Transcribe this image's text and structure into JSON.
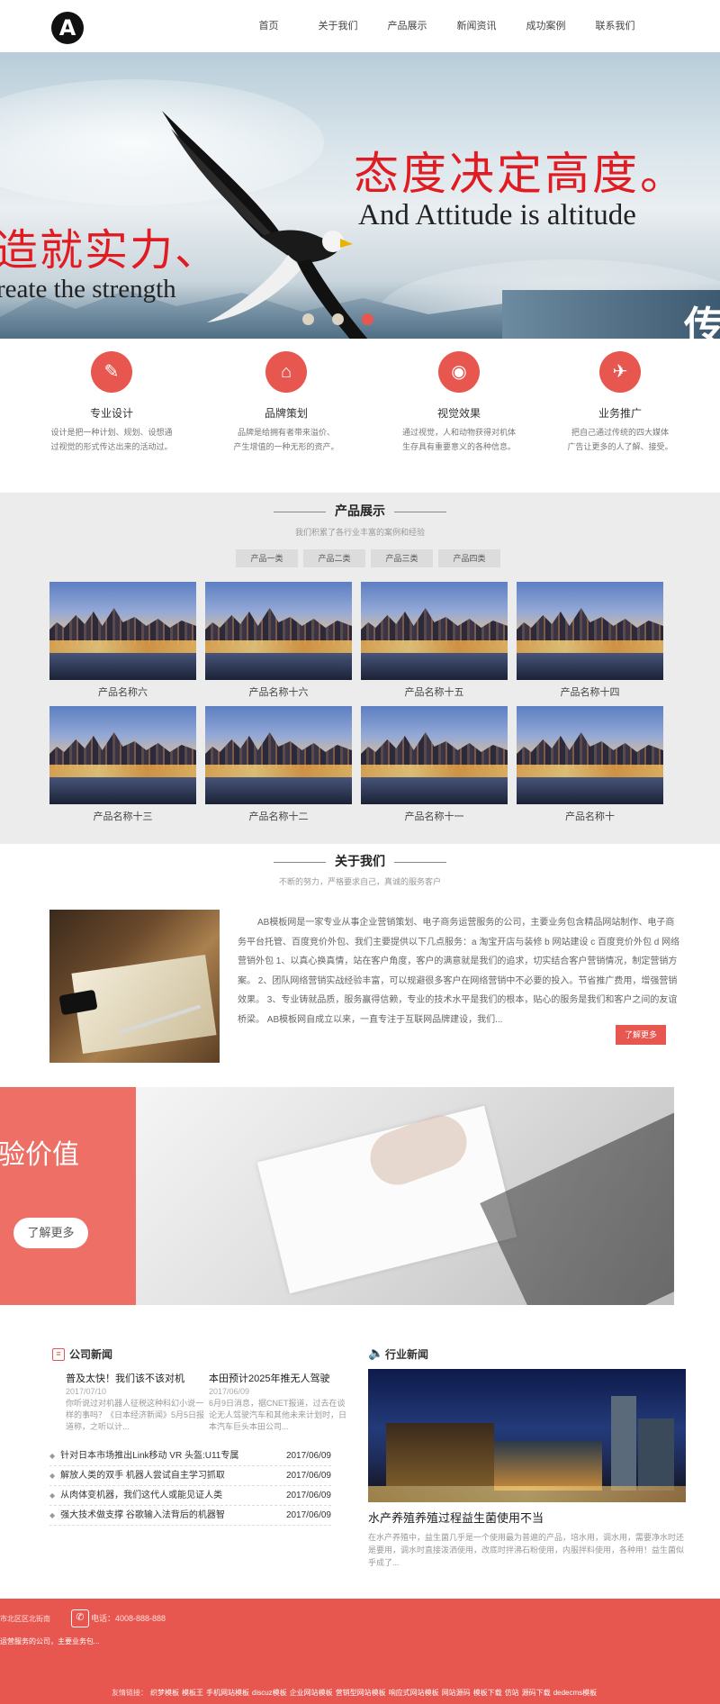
{
  "header": {
    "logo_letter": "A",
    "nav": [
      "首页",
      "关于我们",
      "产品展示",
      "新闻资讯",
      "成功案例",
      "联系我们"
    ]
  },
  "banner": {
    "main_cn": "态度决定高度。",
    "main_en": "And Attitude is altitude",
    "left_cn": "造就实力、",
    "left_en": "reate the strength",
    "rock_char": "传",
    "active_slide": 3,
    "slide_count": 3
  },
  "services": [
    {
      "icon": "edit-icon",
      "glyph": "✎",
      "title": "专业设计",
      "desc1": "设计是把一种计划、规划、设想通",
      "desc2": "过视觉的形式传达出来的活动过。"
    },
    {
      "icon": "tag-icon",
      "glyph": "⌂",
      "title": "品牌策划",
      "desc1": "品牌是给拥有者带来溢价、",
      "desc2": "产生增值的一种无形的资产。"
    },
    {
      "icon": "camera-icon",
      "glyph": "◉",
      "title": "视觉效果",
      "desc1": "通过视觉，人和动物获得对机体",
      "desc2": "生存具有重要意义的各种信息。"
    },
    {
      "icon": "airplane-icon",
      "glyph": "✈",
      "title": "业务推广",
      "desc1": "把自己通过传统的四大媒体",
      "desc2": "广告让更多的人了解、接受。"
    }
  ],
  "products": {
    "title": "产品展示",
    "subtitle": "我们积累了各行业丰富的案例和经验",
    "tabs": [
      "产品一类",
      "产品二类",
      "产品三类",
      "产品四类"
    ],
    "items": [
      "产品名称六",
      "产品名称十六",
      "产品名称十五",
      "产品名称十四",
      "产品名称十三",
      "产品名称十二",
      "产品名称十一",
      "产品名称十"
    ]
  },
  "about": {
    "title": "关于我们",
    "subtitle": "不断的努力，严格要求自己，真诚的服务客户",
    "text": "AB模板网是一家专业从事企业营销策划、电子商务运营服务的公司，主要业务包含精品网站制作、电子商务平台托管、百度竞价外包、我们主要提供以下几点服务：a 淘宝开店与装修 b 网站建设 c 百度竞价外包 d 网络营销外包 1、以真心换真情，站在客户角度，客户的满意就是我们的追求，切实结合客户营销情况，制定营销方案。 2、团队网络营销实战经验丰富，可以规避很多客户在网络营销中不必要的投入。节省推广费用，增强营销效果。 3、专业铸就品质，服务赢得信赖，专业的技术水平是我们的根本，贴心的服务是我们和客户之间的友谊桥梁。 AB模板网自成立以来，一直专注于互联网品牌建设，我们...",
    "more": "了解更多"
  },
  "value_banner": {
    "text": "验价值",
    "button": "了解更多"
  },
  "company_news": {
    "title": "公司新闻",
    "featured": [
      {
        "title": "普及太快！我们该不该对机",
        "date": "2017/07/10",
        "desc": "你听说过对机器人征税这种科幻小说一样的事吗？《日本经济新闻》5月5日报道称，之听以计..."
      },
      {
        "title": "本田预计2025年推无人驾驶",
        "date": "2017/06/09",
        "desc": "6月9日消息，据CNET报道，过去在谈论无人驾驶汽车和其他未来计划时，日本汽车巨头本田公司..."
      }
    ],
    "list": [
      {
        "title": "针对日本市场推出Link移动 VR 头盔:U11专属",
        "date": "2017/06/09"
      },
      {
        "title": "解放人类的双手 机器人尝试自主学习抓取",
        "date": "2017/06/09"
      },
      {
        "title": "从肉体变机器，我们这代人或能见证人类",
        "date": "2017/06/09"
      },
      {
        "title": "强大技术做支撑 谷歌输入法背后的机器智",
        "date": "2017/06/09"
      }
    ]
  },
  "industry_news": {
    "title": "行业新闻",
    "headline": "水产养殖养殖过程益生菌使用不当",
    "desc": "在水产养殖中，益生菌几乎是一个使用最为普遍的产品，培水用，调水用，需要净水时还是要用，调水时直接泼洒使用，改底时拌沸石粉使用，内服拌料使用，各种用！益生菌似乎成了..."
  },
  "footer": {
    "address": "市北区区北街南",
    "phone": "电话：4008-888-888",
    "intro": "运营服务的公司，主要业务包...",
    "links_label": "友情链接：",
    "links": [
      "织梦模板",
      "模板王",
      "手机网站模板",
      "discuz模板",
      "企业网站模板",
      "营销型网站模板",
      "响应式网站模板",
      "网站源码",
      "模板下载",
      "仿站",
      "源码下载",
      "dedecms模板"
    ]
  }
}
